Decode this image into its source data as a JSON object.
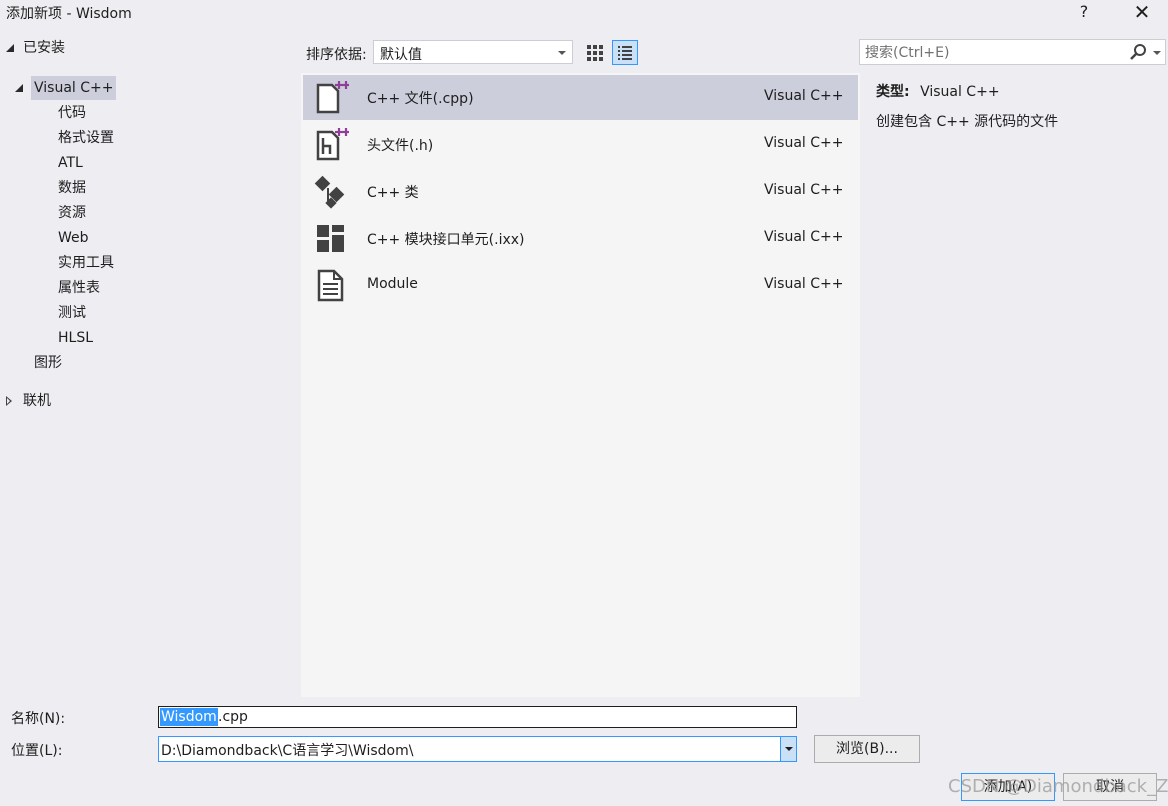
{
  "window": {
    "title": "添加新项 - Wisdom",
    "help_label": "?",
    "close_label": "✕"
  },
  "tree": {
    "installed": "已安装",
    "visual_cpp": "Visual C++",
    "children": [
      "代码",
      "格式设置",
      "ATL",
      "数据",
      "资源",
      "Web",
      "实用工具",
      "属性表",
      "测试",
      "HLSL"
    ],
    "graphics": "图形",
    "online": "联机"
  },
  "toolbar": {
    "sort_label": "排序依据:",
    "sort_value": "默认值"
  },
  "search": {
    "placeholder": "搜索(Ctrl+E)"
  },
  "templates": [
    {
      "name": "C++ 文件(.cpp)",
      "lang": "Visual C++",
      "icon": "cpp-file-icon",
      "selected": true
    },
    {
      "name": "头文件(.h)",
      "lang": "Visual C++",
      "icon": "header-file-icon",
      "selected": false
    },
    {
      "name": "C++ 类",
      "lang": "Visual C++",
      "icon": "cpp-class-icon",
      "selected": false
    },
    {
      "name": "C++ 模块接口单元(.ixx)",
      "lang": "Visual C++",
      "icon": "module-interface-icon",
      "selected": false
    },
    {
      "name": "Module",
      "lang": "Visual C++",
      "icon": "module-document-icon",
      "selected": false
    }
  ],
  "details": {
    "type_label": "类型:",
    "type_value": "Visual C++",
    "description": "创建包含 C++ 源代码的文件"
  },
  "form": {
    "name_label": "名称(N):",
    "name_selected": "Wisdom",
    "name_rest": ".cpp",
    "location_label": "位置(L):",
    "location_value": "D:\\Diamondback\\C语言学习\\Wisdom\\",
    "browse_label": "浏览(B)...",
    "add_label": "添加(A)",
    "cancel_label": "取消"
  },
  "watermark": "CSDN @Diamondback_Z",
  "colors": {
    "selection": "#cccedb",
    "accent": "#3399ff",
    "background": "#eeeef2"
  }
}
